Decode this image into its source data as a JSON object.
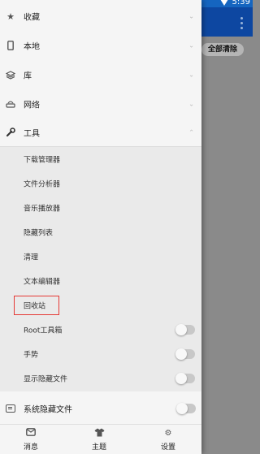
{
  "status_bar": {
    "time": "5:39"
  },
  "background_app": {
    "clear_all_label": "全部清除"
  },
  "drawer": {
    "sections": [
      {
        "label": "收藏",
        "icon": "star-icon"
      },
      {
        "label": "本地",
        "icon": "phone-icon"
      },
      {
        "label": "库",
        "icon": "layers-icon"
      },
      {
        "label": "网络",
        "icon": "router-icon"
      },
      {
        "label": "工具",
        "icon": "wrench-icon",
        "expanded": true
      }
    ],
    "tools": {
      "items": [
        {
          "label": "下载管理器"
        },
        {
          "label": "文件分析器"
        },
        {
          "label": "音乐播放器"
        },
        {
          "label": "隐藏列表"
        },
        {
          "label": "清理"
        },
        {
          "label": "文本编辑器"
        },
        {
          "label": "回收站",
          "highlighted": true
        },
        {
          "label": "Root工具箱",
          "toggle": false
        },
        {
          "label": "手势",
          "toggle": false
        },
        {
          "label": "显示隐藏文件",
          "toggle": false
        }
      ]
    },
    "system_hidden_files": {
      "label": "系统隐藏文件",
      "toggle": false
    },
    "bottom_nav": [
      {
        "label": "消息",
        "icon": "message-icon"
      },
      {
        "label": "主题",
        "icon": "shirt-icon"
      },
      {
        "label": "设置",
        "icon": "gear-icon"
      }
    ]
  },
  "colors": {
    "status_bar": "#1565c0",
    "app_header": "#0d47a1",
    "drawer_bg": "#f5f5f5",
    "tools_bg": "#eaeaea",
    "highlight": "#e53935"
  }
}
